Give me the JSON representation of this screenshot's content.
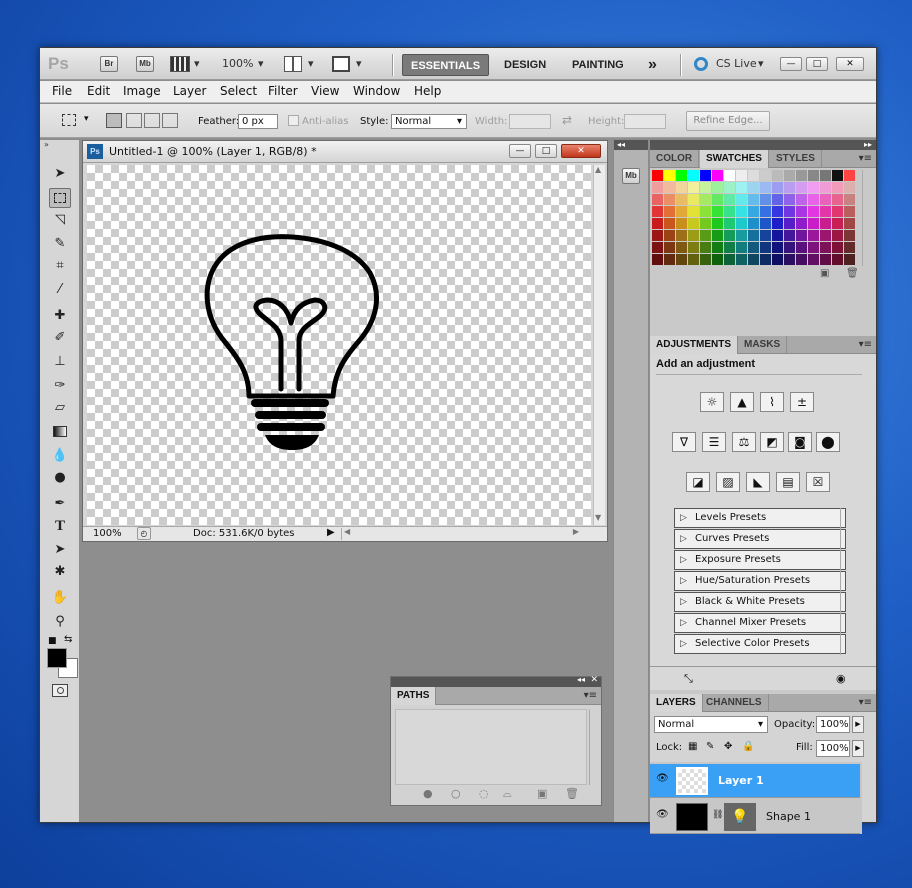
{
  "app": {
    "logo": "Ps",
    "bridge": "Br",
    "minibridge": "Mb",
    "zoom": "100%",
    "workspaces": [
      "ESSENTIALS",
      "DESIGN",
      "PAINTING"
    ],
    "more": "»",
    "cslive": "CS Live"
  },
  "menu": [
    "File",
    "Edit",
    "Image",
    "Layer",
    "Select",
    "Filter",
    "View",
    "Window",
    "Help"
  ],
  "options": {
    "feather_label": "Feather:",
    "feather_value": "0 px",
    "antialias_label": "Anti-alias",
    "style_label": "Style:",
    "style_value": "Normal",
    "width_label": "Width:",
    "height_label": "Height:",
    "refine_edge": "Refine Edge..."
  },
  "document": {
    "title": "Untitled-1 @ 100% (Layer 1, RGB/8) *",
    "zoom": "100%",
    "doc_info": "Doc: 531.6K/0 bytes",
    "artwork": "lightbulb-outline"
  },
  "swatches_panel": {
    "tabs": [
      "COLOR",
      "SWATCHES",
      "STYLES"
    ],
    "active": "SWATCHES"
  },
  "adjustments_panel": {
    "tabs": [
      "ADJUSTMENTS",
      "MASKS"
    ],
    "heading": "Add an adjustment",
    "presets": [
      "Levels Presets",
      "Curves Presets",
      "Exposure Presets",
      "Hue/Saturation Presets",
      "Black & White Presets",
      "Channel Mixer Presets",
      "Selective Color Presets"
    ]
  },
  "paths_panel": {
    "tab": "PATHS"
  },
  "layers_panel": {
    "tabs": [
      "LAYERS",
      "CHANNELS"
    ],
    "blend_mode": "Normal",
    "opacity_label": "Opacity:",
    "opacity": "100%",
    "lock_label": "Lock:",
    "fill_label": "Fill:",
    "fill": "100%",
    "layers": [
      {
        "name": "Layer 1",
        "selected": true
      },
      {
        "name": "Shape 1",
        "selected": false
      }
    ]
  },
  "colors": {
    "selection": "#3aa0f5",
    "desktop": "#1f5fc6"
  }
}
